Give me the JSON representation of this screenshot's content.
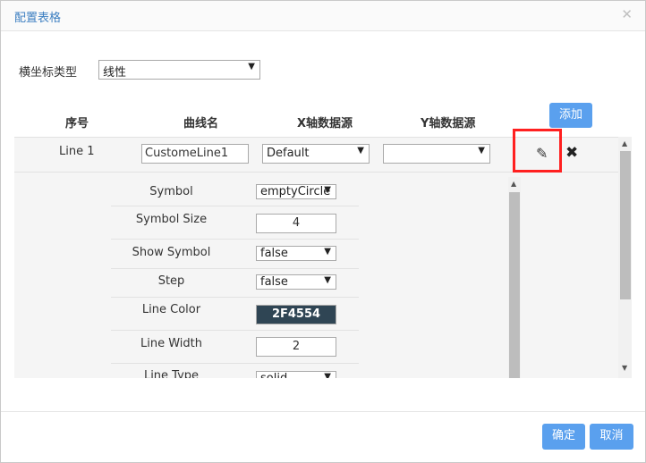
{
  "dialog": {
    "title": "配置表格",
    "close_icon": "✕"
  },
  "xaxis": {
    "label": "横坐标类型",
    "selected": "线性"
  },
  "table": {
    "headers": [
      "序号",
      "曲线名",
      "X轴数据源",
      "Y轴数据源"
    ],
    "add_label": "添加",
    "rows": [
      {
        "name": "Line 1",
        "curve": "CustomeLine1",
        "x_source": "Default",
        "y_source": ""
      }
    ]
  },
  "properties": [
    {
      "label": "Symbol",
      "value": "emptyCircle"
    },
    {
      "label": "Symbol Size",
      "value": "4"
    },
    {
      "label": "Show Symbol",
      "value": "false"
    },
    {
      "label": "Step",
      "value": "false"
    },
    {
      "label": "Line Color",
      "value": "2F4554"
    },
    {
      "label": "Line Width",
      "value": "2"
    },
    {
      "label": "Line Type",
      "value": "solid"
    }
  ],
  "colors": {
    "accent": "#5aa0ee",
    "line_color": "#2f4554",
    "highlight": "#ff2020"
  },
  "footer": {
    "ok_label": "确定",
    "cancel_label": "取消"
  }
}
